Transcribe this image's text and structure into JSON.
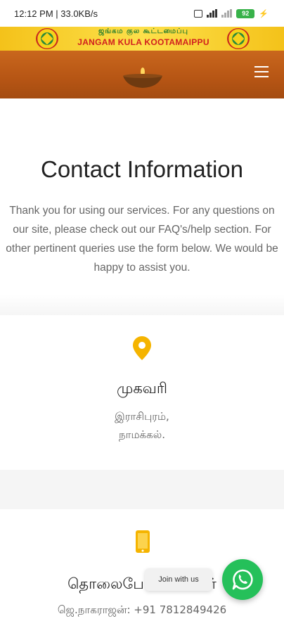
{
  "status_bar": {
    "time_speed": "12:12 PM | 33.0KB/s",
    "battery": "92"
  },
  "banner": {
    "tamil_text": "ஜங்கம குல கூட்டமைப்பு",
    "english_text": "JANGAM KULA KOOTAMAIPPU"
  },
  "page": {
    "title": "Contact Information",
    "intro": "Thank you for using our services. For any questions on our site, please check out our FAQ's/help section. For other pertinent queries use the form below. We would be happy to assist you."
  },
  "address": {
    "heading": "முகவரி",
    "line1": "இராசிபுரம்,",
    "line2": "நாமக்கல்."
  },
  "phone": {
    "heading": "தொலைபே",
    "heading_tail": "ர்",
    "line": "ஜெ.நாகராஜன்: +91 7812849426"
  },
  "whatsapp": {
    "join_label": "Join with us"
  },
  "colors": {
    "accent_icon": "#f5b400",
    "whatsapp": "#25c05a",
    "hero": "#b65514",
    "banner": "#f4c21a"
  },
  "icons": {
    "menu": "hamburger-menu-icon",
    "address": "map-pin-icon",
    "phone": "mobile-phone-icon",
    "whatsapp": "whatsapp-icon",
    "logo": "jangam-emblem-icon"
  }
}
